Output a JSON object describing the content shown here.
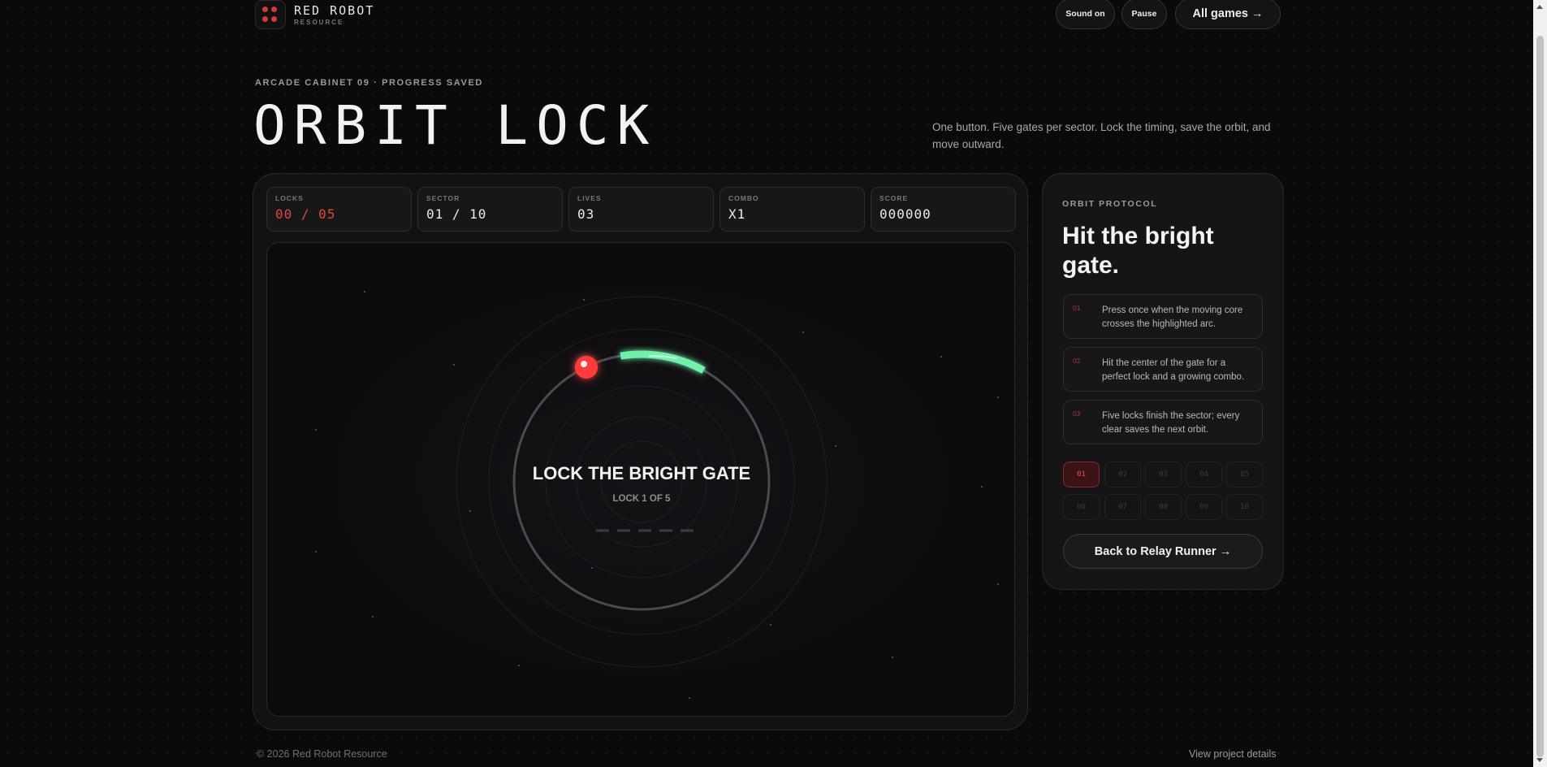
{
  "header": {
    "brand_name": "RED ROBOT",
    "brand_sub": "RESOURCE",
    "sound_label": "Sound on",
    "pause_label": "Pause",
    "all_games_label": "All games →"
  },
  "hero": {
    "kicker": "ARCADE CABINET 09 · PROGRESS SAVED",
    "title": "ORBIT LOCK",
    "intro": "One button. Five gates per sector. Lock the timing, save the orbit, and move outward."
  },
  "stats": [
    {
      "label": "LOCKS",
      "value": "00 / 05",
      "color": "#e04545"
    },
    {
      "label": "SECTOR",
      "value": "01 / 10",
      "color": "#eaeaea"
    },
    {
      "label": "LIVES",
      "value": "03",
      "color": "#eaeaea"
    },
    {
      "label": "COMBO",
      "value": "X1",
      "color": "#eaeaea"
    },
    {
      "label": "SCORE",
      "value": "000000",
      "color": "#eaeaea"
    }
  ],
  "stage": {
    "prompt": "LOCK THE BRIGHT GATE",
    "sub_prompt": "LOCK 1 OF 5",
    "progress_slots": 5,
    "locks_done": 0,
    "gate_color": "#6ff0a8",
    "core_color": "#ff3b3b"
  },
  "side": {
    "kicker": "ORBIT PROTOCOL",
    "headline": "Hit the bright gate.",
    "rules": [
      {
        "num": "01",
        "text": "Press once when the moving core crosses the highlighted arc."
      },
      {
        "num": "02",
        "text": "Hit the center of the gate for a perfect lock and a growing combo."
      },
      {
        "num": "03",
        "text": "Five locks finish the sector; every clear saves the next orbit."
      }
    ],
    "levels": [
      "01",
      "02",
      "03",
      "04",
      "05",
      "06",
      "07",
      "08",
      "09",
      "10"
    ],
    "active_level": "01",
    "back_label": "Back to Relay Runner →"
  },
  "footer": {
    "copyright": "© 2026 Red Robot Resource",
    "details_label": "View project details"
  },
  "colors": {
    "accent": "#e04545",
    "gate": "#6ff0a8",
    "background": "#0a0a0b"
  }
}
